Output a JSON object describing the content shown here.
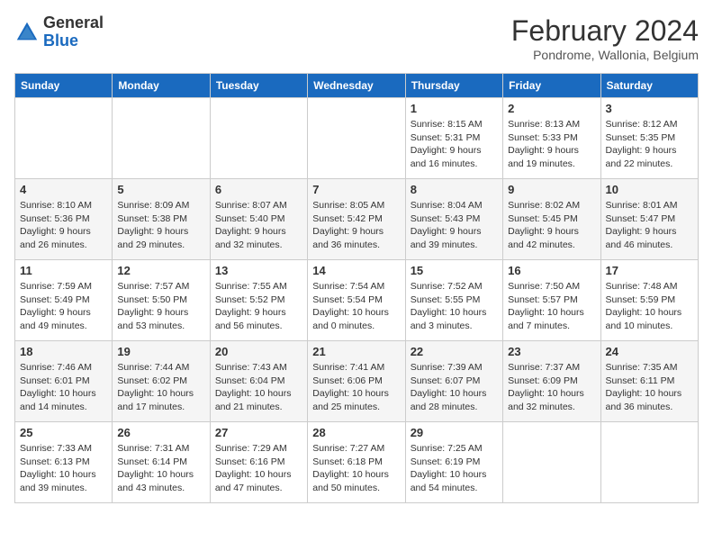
{
  "header": {
    "logo_general": "General",
    "logo_blue": "Blue",
    "month_title": "February 2024",
    "location": "Pondrome, Wallonia, Belgium"
  },
  "days_of_week": [
    "Sunday",
    "Monday",
    "Tuesday",
    "Wednesday",
    "Thursday",
    "Friday",
    "Saturday"
  ],
  "weeks": [
    [
      {
        "day": "",
        "detail": ""
      },
      {
        "day": "",
        "detail": ""
      },
      {
        "day": "",
        "detail": ""
      },
      {
        "day": "",
        "detail": ""
      },
      {
        "day": "1",
        "detail": "Sunrise: 8:15 AM\nSunset: 5:31 PM\nDaylight: 9 hours\nand 16 minutes."
      },
      {
        "day": "2",
        "detail": "Sunrise: 8:13 AM\nSunset: 5:33 PM\nDaylight: 9 hours\nand 19 minutes."
      },
      {
        "day": "3",
        "detail": "Sunrise: 8:12 AM\nSunset: 5:35 PM\nDaylight: 9 hours\nand 22 minutes."
      }
    ],
    [
      {
        "day": "4",
        "detail": "Sunrise: 8:10 AM\nSunset: 5:36 PM\nDaylight: 9 hours\nand 26 minutes."
      },
      {
        "day": "5",
        "detail": "Sunrise: 8:09 AM\nSunset: 5:38 PM\nDaylight: 9 hours\nand 29 minutes."
      },
      {
        "day": "6",
        "detail": "Sunrise: 8:07 AM\nSunset: 5:40 PM\nDaylight: 9 hours\nand 32 minutes."
      },
      {
        "day": "7",
        "detail": "Sunrise: 8:05 AM\nSunset: 5:42 PM\nDaylight: 9 hours\nand 36 minutes."
      },
      {
        "day": "8",
        "detail": "Sunrise: 8:04 AM\nSunset: 5:43 PM\nDaylight: 9 hours\nand 39 minutes."
      },
      {
        "day": "9",
        "detail": "Sunrise: 8:02 AM\nSunset: 5:45 PM\nDaylight: 9 hours\nand 42 minutes."
      },
      {
        "day": "10",
        "detail": "Sunrise: 8:01 AM\nSunset: 5:47 PM\nDaylight: 9 hours\nand 46 minutes."
      }
    ],
    [
      {
        "day": "11",
        "detail": "Sunrise: 7:59 AM\nSunset: 5:49 PM\nDaylight: 9 hours\nand 49 minutes."
      },
      {
        "day": "12",
        "detail": "Sunrise: 7:57 AM\nSunset: 5:50 PM\nDaylight: 9 hours\nand 53 minutes."
      },
      {
        "day": "13",
        "detail": "Sunrise: 7:55 AM\nSunset: 5:52 PM\nDaylight: 9 hours\nand 56 minutes."
      },
      {
        "day": "14",
        "detail": "Sunrise: 7:54 AM\nSunset: 5:54 PM\nDaylight: 10 hours\nand 0 minutes."
      },
      {
        "day": "15",
        "detail": "Sunrise: 7:52 AM\nSunset: 5:55 PM\nDaylight: 10 hours\nand 3 minutes."
      },
      {
        "day": "16",
        "detail": "Sunrise: 7:50 AM\nSunset: 5:57 PM\nDaylight: 10 hours\nand 7 minutes."
      },
      {
        "day": "17",
        "detail": "Sunrise: 7:48 AM\nSunset: 5:59 PM\nDaylight: 10 hours\nand 10 minutes."
      }
    ],
    [
      {
        "day": "18",
        "detail": "Sunrise: 7:46 AM\nSunset: 6:01 PM\nDaylight: 10 hours\nand 14 minutes."
      },
      {
        "day": "19",
        "detail": "Sunrise: 7:44 AM\nSunset: 6:02 PM\nDaylight: 10 hours\nand 17 minutes."
      },
      {
        "day": "20",
        "detail": "Sunrise: 7:43 AM\nSunset: 6:04 PM\nDaylight: 10 hours\nand 21 minutes."
      },
      {
        "day": "21",
        "detail": "Sunrise: 7:41 AM\nSunset: 6:06 PM\nDaylight: 10 hours\nand 25 minutes."
      },
      {
        "day": "22",
        "detail": "Sunrise: 7:39 AM\nSunset: 6:07 PM\nDaylight: 10 hours\nand 28 minutes."
      },
      {
        "day": "23",
        "detail": "Sunrise: 7:37 AM\nSunset: 6:09 PM\nDaylight: 10 hours\nand 32 minutes."
      },
      {
        "day": "24",
        "detail": "Sunrise: 7:35 AM\nSunset: 6:11 PM\nDaylight: 10 hours\nand 36 minutes."
      }
    ],
    [
      {
        "day": "25",
        "detail": "Sunrise: 7:33 AM\nSunset: 6:13 PM\nDaylight: 10 hours\nand 39 minutes."
      },
      {
        "day": "26",
        "detail": "Sunrise: 7:31 AM\nSunset: 6:14 PM\nDaylight: 10 hours\nand 43 minutes."
      },
      {
        "day": "27",
        "detail": "Sunrise: 7:29 AM\nSunset: 6:16 PM\nDaylight: 10 hours\nand 47 minutes."
      },
      {
        "day": "28",
        "detail": "Sunrise: 7:27 AM\nSunset: 6:18 PM\nDaylight: 10 hours\nand 50 minutes."
      },
      {
        "day": "29",
        "detail": "Sunrise: 7:25 AM\nSunset: 6:19 PM\nDaylight: 10 hours\nand 54 minutes."
      },
      {
        "day": "",
        "detail": ""
      },
      {
        "day": "",
        "detail": ""
      }
    ]
  ]
}
